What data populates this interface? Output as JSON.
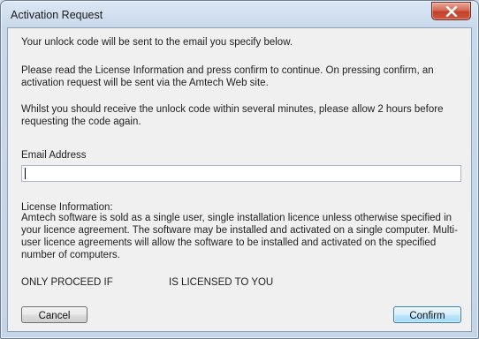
{
  "window": {
    "title": "Activation Request",
    "close_icon": "close-icon"
  },
  "intro": {
    "line1": "Your unlock code will be sent to the email you specify below.",
    "line2": "Please read the License Information and press confirm to continue. On pressing confirm, an activation request will be sent via the Amtech Web site.",
    "line3": "Whilst you should receive the unlock code within several minutes, please allow 2 hours before requesting the code again."
  },
  "email": {
    "label": "Email Address",
    "value": ""
  },
  "license": {
    "title": "License Information:",
    "body": "Amtech software is sold as a single user, single installation licence unless otherwise specified in your licence agreement. The software may be installed and activated on a single computer. Multi-user licence agreements will allow the software to be installed and activated on the specified number of computers.",
    "proceed_prefix": "ONLY PROCEED IF",
    "proceed_suffix": "IS LICENSED TO YOU"
  },
  "buttons": {
    "cancel": "Cancel",
    "confirm": "Confirm"
  }
}
